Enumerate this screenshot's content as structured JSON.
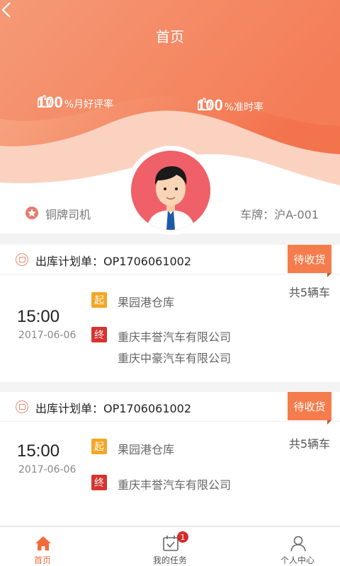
{
  "header": {
    "title": "首页",
    "stats": [
      {
        "value": "100",
        "unit": "%月好评率"
      },
      {
        "value": "100",
        "unit": "%准时率"
      }
    ]
  },
  "profile": {
    "level": "铜牌司机",
    "plate": "车牌：沪A-001"
  },
  "orders": [
    {
      "plan": "出库计划单：OP1706061002",
      "status": "待收货",
      "count": "共5辆车",
      "time": "15:00",
      "date": "2017-06-06",
      "start_tag": "起",
      "start": "果园港仓库",
      "end_tag": "终",
      "ends": [
        "重庆丰誉汽车有限公司",
        "重庆中豪汽车有限公司"
      ]
    },
    {
      "plan": "出库计划单：OP1706061002",
      "status": "待收货",
      "count": "共5辆车",
      "time": "15:00",
      "date": "2017-06-06",
      "start_tag": "起",
      "start": "果园港仓库",
      "end_tag": "终",
      "ends": [
        "重庆丰誉汽车有限公司"
      ]
    }
  ],
  "tabbar": {
    "items": [
      {
        "label": "首页",
        "icon": "home-icon"
      },
      {
        "label": "我的任务",
        "icon": "calendar-icon",
        "badge": "1"
      },
      {
        "label": "个人中心",
        "icon": "person-icon"
      }
    ]
  },
  "colors": {
    "accent": "#f36b3a",
    "status": "#f57c4d",
    "start_tag": "#f5a623",
    "end_tag": "#d9322f"
  }
}
